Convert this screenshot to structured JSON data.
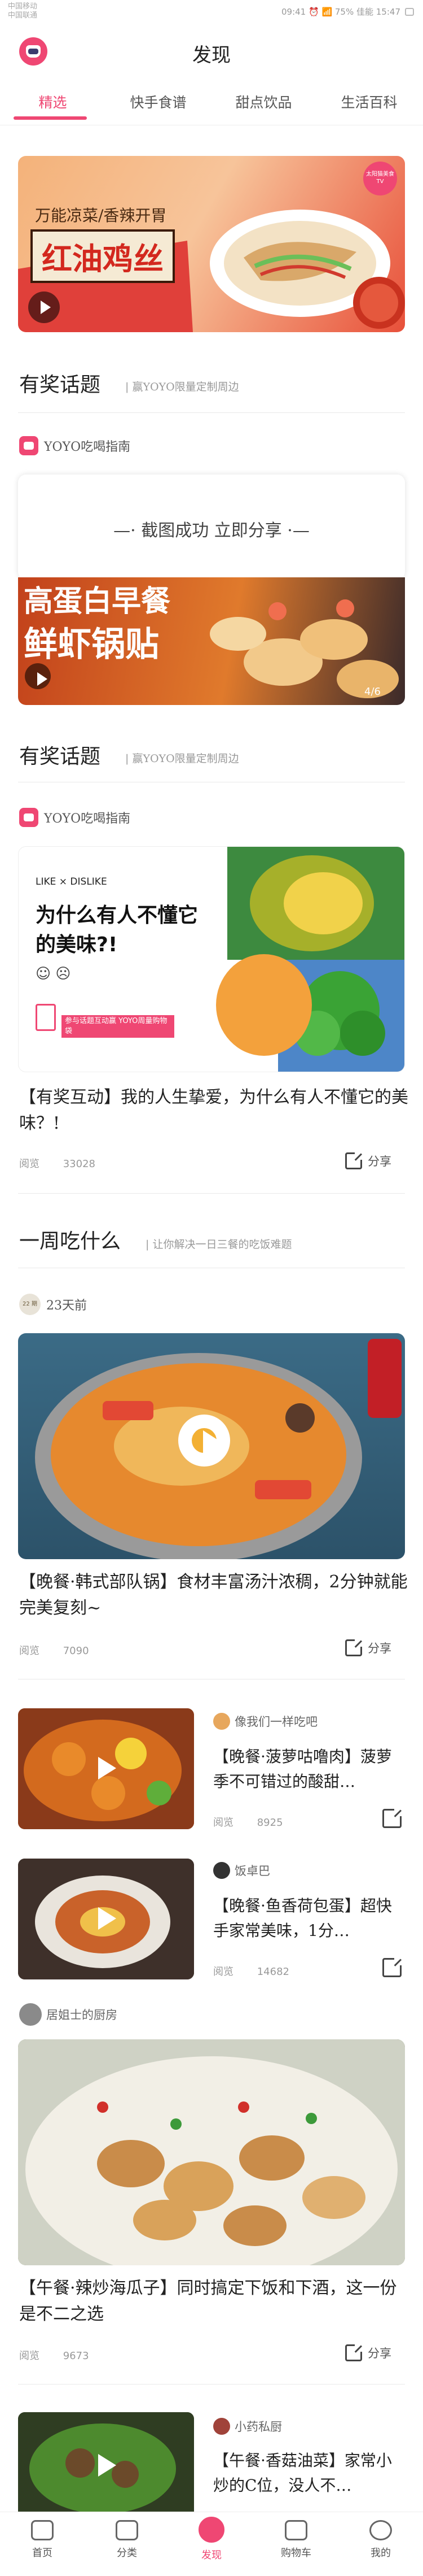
{
  "status_bar": {
    "carrier_line1": "中国移动",
    "carrier_line2": "中国联通",
    "right_text": "09:41 ⏰ 📶 75% 佳能 15:47"
  },
  "header": {
    "title": "发现"
  },
  "tabs": [
    {
      "label": "精选",
      "active": true
    },
    {
      "label": "快手食谱",
      "active": false
    },
    {
      "label": "甜点饮品",
      "active": false
    },
    {
      "label": "生活百科",
      "active": false
    }
  ],
  "banner1": {
    "headline_top": "万能凉菜/香辣开胃",
    "headline_main": "红油鸡丝",
    "badge": "太阳猫美食TV"
  },
  "section1": {
    "title": "有奖话题",
    "subtitle": "| 赢YOYO限量定制周边",
    "author": "YOYO吃喝指南"
  },
  "overlay_popup": {
    "text": "—· 截图成功 立即分享 ·—"
  },
  "banner2": {
    "headline_top": "高蛋白早餐",
    "headline_main": "鲜虾锅贴",
    "counter": "4/6"
  },
  "section2": {
    "title": "有奖话题",
    "subtitle": "| 赢YOYO限量定制周边",
    "author": "YOYO吃喝指南"
  },
  "topic_card": {
    "tag": "LIKE × DISLIKE",
    "headline": "为什么有人不懂它的美味?!",
    "promo": "参与话题互动赢 YOYO周量购物袋"
  },
  "topic_post": {
    "title": "【有奖互动】我的人生挚爱，为什么有人不懂它的美味？!",
    "views_label": "阅览",
    "views_count": "33028",
    "share_label": "分享"
  },
  "section3": {
    "title": "一周吃什么",
    "subtitle": "| 让你解决一日三餐的吃饭难题",
    "issue_badge": "22 期",
    "issue_label": "23天前"
  },
  "week_post": {
    "title": "【晚餐·韩式部队锅】食材丰富汤汁浓稠，2分钟就能完美复刻~",
    "views_label": "阅览",
    "views_count": "7090",
    "share_label": "分享"
  },
  "mini_posts": [
    {
      "author": "像我们一样吃吧",
      "title": "【晚餐·菠萝咕噜肉】菠萝季不可错过的酸甜…",
      "views_label": "阅览",
      "views_count": "8925"
    },
    {
      "author": "饭卓巴",
      "title": "【晚餐·鱼香荷包蛋】超快手家常美味，1分…",
      "views_label": "阅览",
      "views_count": "14682"
    }
  ],
  "clam_post": {
    "author": "居姐士的厨房",
    "title": "【午餐·辣炒海瓜子】同时搞定下饭和下酒，这一份是不二之选",
    "views_label": "阅览",
    "views_count": "9673",
    "share_label": "分享"
  },
  "last_post": {
    "author": "小药私厨",
    "title": "【午餐·香菇油菜】家常小炒的C位，没人不…"
  },
  "bottom_nav": [
    {
      "label": "首页",
      "icon": "home-icon",
      "active": false
    },
    {
      "label": "分类",
      "icon": "category-icon",
      "active": false
    },
    {
      "label": "发现",
      "icon": "discover-icon",
      "active": true
    },
    {
      "label": "购物车",
      "icon": "cart-icon",
      "active": false
    },
    {
      "label": "我的",
      "icon": "profile-icon",
      "active": false
    }
  ]
}
